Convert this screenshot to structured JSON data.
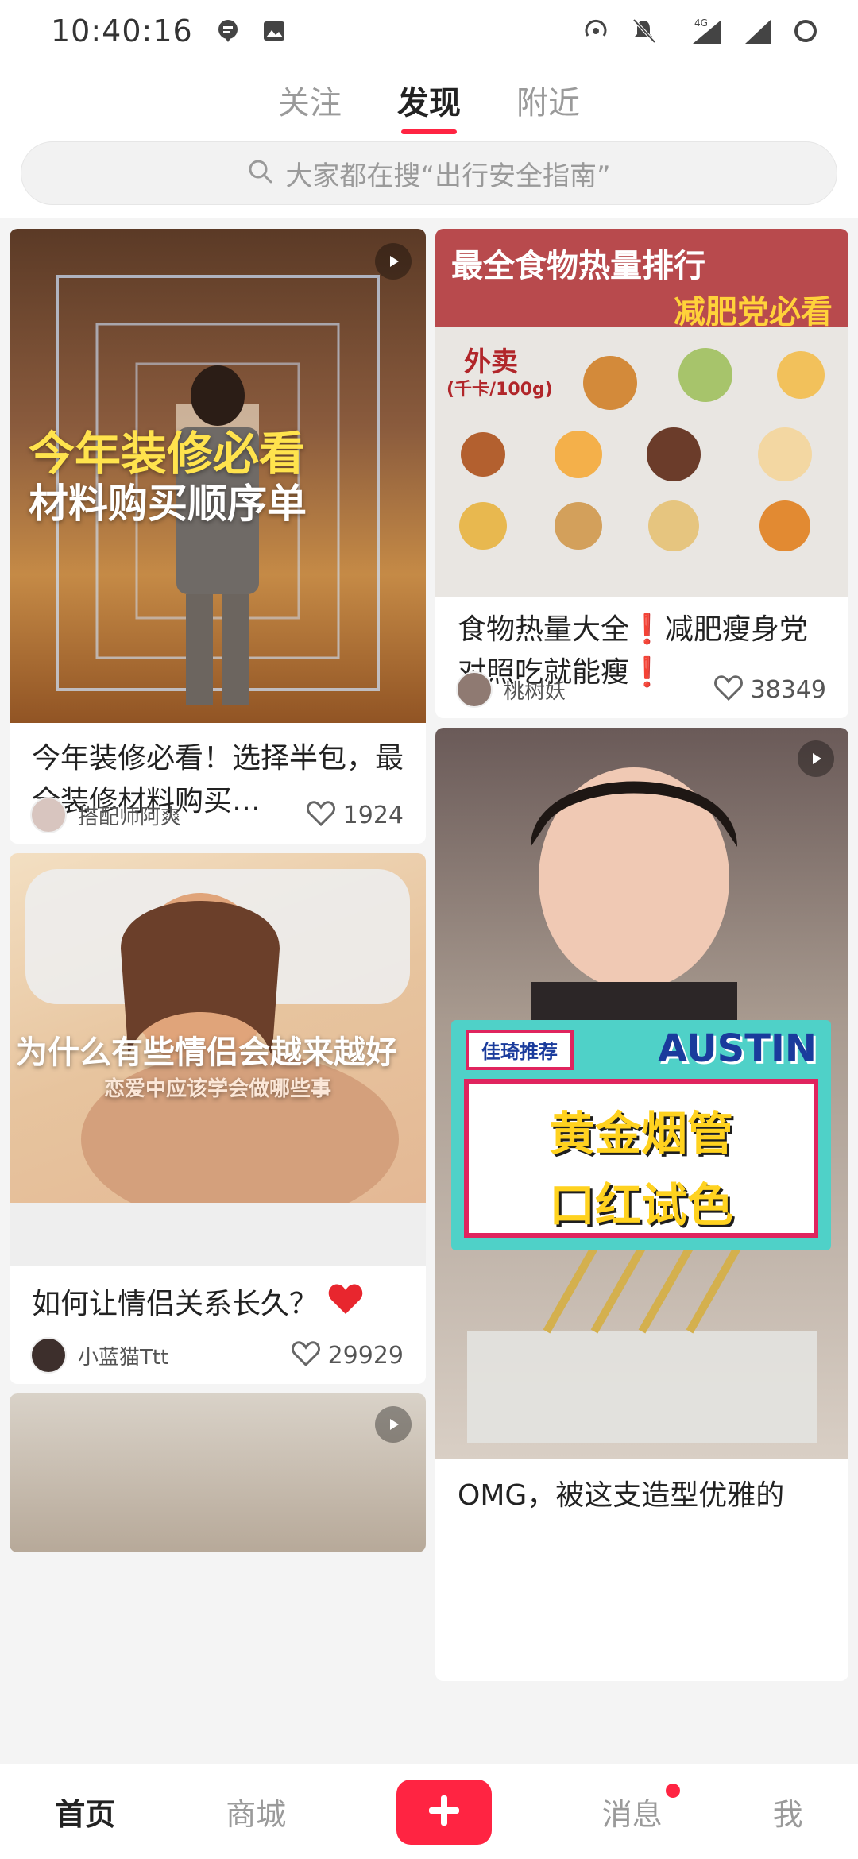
{
  "status_bar": {
    "time": "10:40:16",
    "network": "4G"
  },
  "top_tabs": [
    {
      "label": "关注"
    },
    {
      "label": "发现"
    },
    {
      "label": "附近"
    }
  ],
  "search": {
    "placeholder": "大家都在搜“出行安全指南”"
  },
  "feed": {
    "cards": [
      {
        "overlay_line1": "今年装修必看",
        "overlay_line2": "材料购买顺序单",
        "title": "今年装修必看！选择半包，最全装修材料购买…",
        "author": "搭配师阿爽",
        "likes": "1924"
      },
      {
        "header_line1": "最全食物热量排行",
        "header_line2": "减肥党必看",
        "label_takeout": "外卖",
        "label_unit": "(千卡/100g)",
        "title": "食物热量大全❗减肥瘦身党对照吃就能瘦❗",
        "author": "桃树妖",
        "likes": "38349"
      },
      {
        "overlay_line1": "为什么有些情侣会越来越好",
        "overlay_line2": "恋爱中应该学会做哪些事",
        "title": "如何让情侣关系长久？",
        "author": "小蓝猫Ttt",
        "likes": "29929"
      },
      {
        "tag": "佳琦推荐",
        "brand": "AUSTIN",
        "overlay_line1": "黄金烟管",
        "overlay_line2": "口红试色",
        "title": "OMG，被这支造型优雅的"
      }
    ]
  },
  "bottom_nav": {
    "items": [
      {
        "label": "首页"
      },
      {
        "label": "商城"
      },
      {
        "label": "消息"
      },
      {
        "label": "我"
      }
    ]
  },
  "colors": {
    "accent": "#ff2442",
    "text_primary": "#222222",
    "text_secondary": "#9a9a9a"
  }
}
